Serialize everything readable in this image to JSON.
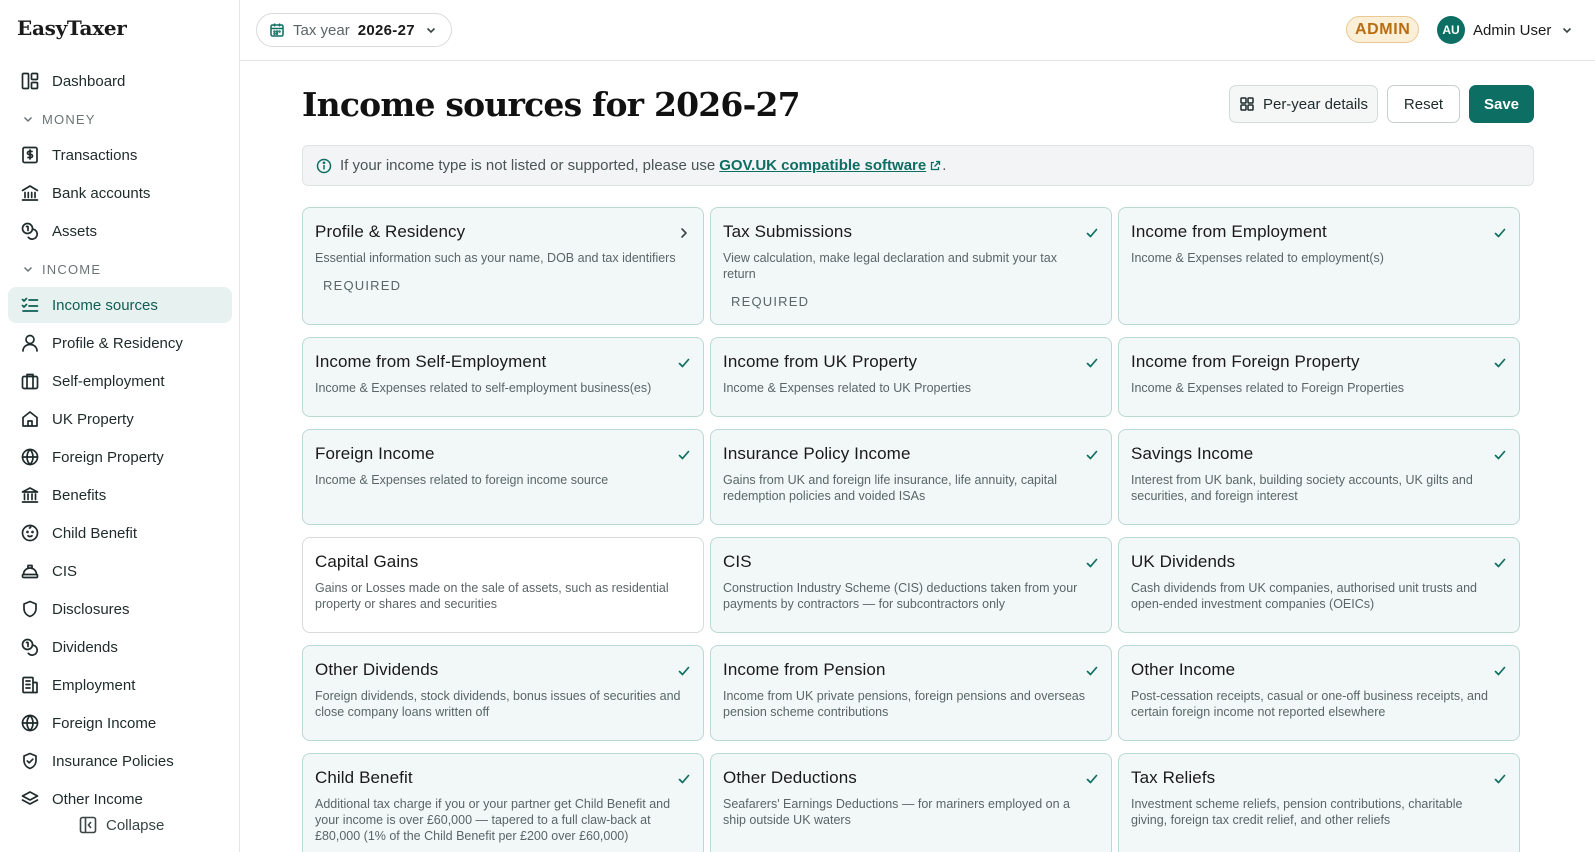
{
  "app": {
    "name": "EasyTaxer"
  },
  "sidebar": {
    "items": [
      {
        "type": "item",
        "label": "Dashboard",
        "icon": "dashboard-icon"
      },
      {
        "type": "section",
        "label": "MONEY"
      },
      {
        "type": "item",
        "label": "Transactions",
        "icon": "receipt-icon"
      },
      {
        "type": "item",
        "label": "Bank accounts",
        "icon": "bank-icon"
      },
      {
        "type": "item",
        "label": "Assets",
        "icon": "coins-icon"
      },
      {
        "type": "section",
        "label": "INCOME"
      },
      {
        "type": "item",
        "label": "Income sources",
        "icon": "list-checks-icon",
        "active": true
      },
      {
        "type": "item",
        "label": "Profile & Residency",
        "icon": "user-icon"
      },
      {
        "type": "item",
        "label": "Self-employment",
        "icon": "briefcase-icon"
      },
      {
        "type": "item",
        "label": "UK Property",
        "icon": "home-icon"
      },
      {
        "type": "item",
        "label": "Foreign Property",
        "icon": "globe-icon"
      },
      {
        "type": "item",
        "label": "Benefits",
        "icon": "landmark-icon"
      },
      {
        "type": "item",
        "label": "Child Benefit",
        "icon": "baby-icon"
      },
      {
        "type": "item",
        "label": "CIS",
        "icon": "hard-hat-icon"
      },
      {
        "type": "item",
        "label": "Disclosures",
        "icon": "shield-icon"
      },
      {
        "type": "item",
        "label": "Dividends",
        "icon": "coins-icon"
      },
      {
        "type": "item",
        "label": "Employment",
        "icon": "building-icon"
      },
      {
        "type": "item",
        "label": "Foreign Income",
        "icon": "globe-icon"
      },
      {
        "type": "item",
        "label": "Insurance Policies",
        "icon": "shield-check-icon"
      },
      {
        "type": "item",
        "label": "Other Income",
        "icon": "layers-icon"
      }
    ],
    "collapse_label": "Collapse"
  },
  "topbar": {
    "tax_year_label": "Tax year",
    "tax_year_value": "2026-27",
    "badge": "ADMIN",
    "avatar_initials": "AU",
    "user_name": "Admin User"
  },
  "main": {
    "title": "Income sources for 2026-27",
    "buttons": {
      "per_year": "Per-year details",
      "reset": "Reset",
      "save": "Save"
    },
    "info": {
      "text": "If your income type is not listed or supported, please use",
      "link": "GOV.UK compatible software",
      "suffix": "."
    },
    "cards": [
      {
        "title": "Profile & Residency",
        "desc": "Essential information such as your name, DOB and tax identifiers",
        "required": "REQUIRED",
        "mark": "chevron"
      },
      {
        "title": "Tax Submissions",
        "desc": "View calculation, make legal declaration and submit your tax return",
        "required": "REQUIRED",
        "mark": "check"
      },
      {
        "title": "Income from Employment",
        "desc": "Income & Expenses related to employment(s)",
        "mark": "check"
      },
      {
        "title": "Income from Self-Employment",
        "desc": "Income & Expenses related to self-employment business(es)",
        "mark": "check"
      },
      {
        "title": "Income from UK Property",
        "desc": "Income & Expenses related to UK Properties",
        "mark": "check"
      },
      {
        "title": "Income from Foreign Property",
        "desc": "Income & Expenses related to Foreign Properties",
        "mark": "check"
      },
      {
        "title": "Foreign Income",
        "desc": "Income & Expenses related to foreign income source",
        "mark": "check"
      },
      {
        "title": "Insurance Policy Income",
        "desc": "Gains from UK and foreign life insurance, life annuity, capital redemption policies and voided ISAs",
        "mark": "check"
      },
      {
        "title": "Savings Income",
        "desc": "Interest from UK bank, building society accounts, UK gilts and securities, and foreign interest",
        "mark": "check"
      },
      {
        "title": "Capital Gains",
        "desc": "Gains or Losses made on the sale of assets, such as residential property or shares and securities",
        "mark": "none",
        "plain": true
      },
      {
        "title": "CIS",
        "desc": "Construction Industry Scheme (CIS) deductions taken from your payments by contractors — for subcontractors only",
        "mark": "check"
      },
      {
        "title": "UK Dividends",
        "desc": "Cash dividends from UK companies, authorised unit trusts and open-ended investment companies (OEICs)",
        "mark": "check"
      },
      {
        "title": "Other Dividends",
        "desc": "Foreign dividends, stock dividends, bonus issues of securities and close company loans written off",
        "mark": "check"
      },
      {
        "title": "Income from Pension",
        "desc": "Income from UK private pensions, foreign pensions and overseas pension scheme contributions",
        "mark": "check"
      },
      {
        "title": "Other Income",
        "desc": "Post-cessation receipts, casual or one-off business receipts, and certain foreign income not reported elsewhere",
        "mark": "check"
      },
      {
        "title": "Child Benefit",
        "desc": "Additional tax charge if you or your partner get Child Benefit and your income is over £60,000 — tapered to a full claw-back at £80,000 (1% of the Child Benefit per £200 over £60,000)",
        "mark": "check"
      },
      {
        "title": "Other Deductions",
        "desc": "Seafarers' Earnings Deductions — for mariners employed on a ship outside UK waters",
        "mark": "check"
      },
      {
        "title": "Tax Reliefs",
        "desc": "Investment scheme reliefs, pension contributions, charitable giving, foreign tax credit relief, and other reliefs",
        "mark": "check"
      }
    ]
  },
  "colors": {
    "accent": "#0d6e63",
    "card_bg": "#f2f8f7",
    "card_border": "#b9d9d3",
    "badge_text": "#b96d10",
    "badge_bg": "#fbefd8"
  }
}
